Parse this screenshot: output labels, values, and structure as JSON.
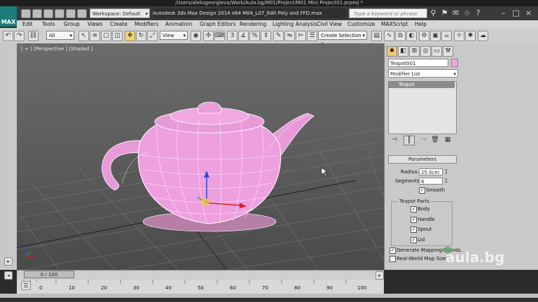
{
  "window": {
    "path": "/Users/aleksgeorgieva/Work/Aula.bg/M01/Project/M01 Mini Project01.prproj *",
    "logo": "MAX",
    "workspace": "Workspace: Default",
    "title": "Autodesk 3ds Max Design 2014 x64     M04_L07_Edit Poly and FFD.max",
    "search_placeholder": "Type a keyword or phrase"
  },
  "menu": [
    "Edit",
    "Tools",
    "Group",
    "Views",
    "Create",
    "Modifiers",
    "Animation",
    "Graph Editors",
    "Rendering",
    "Lighting Analysis",
    "Civil View",
    "Customize",
    "MAXScript",
    "Help"
  ],
  "toolbar": {
    "filter": "All",
    "ref_coord": "View",
    "selection_set": "Create Selection Se"
  },
  "viewport": {
    "label": "[ + ] [Perspective ] [Shaded ]",
    "object_color": "#ee9fe0",
    "wire_color": "#ffffff"
  },
  "command_panel": {
    "object_name": "Teapot001",
    "modifier_list": "Modifier List",
    "stack_item": "Teapot",
    "rollout": "Parameters",
    "radius_label": "Radius:",
    "radius": "25.0cm",
    "segments_label": "Segments:",
    "segments": "6",
    "smooth": "Smooth",
    "parts_title": "Teapot Parts",
    "parts": [
      "Body",
      "Handle",
      "Spout",
      "Lid"
    ],
    "gen_mapping": "Generate Mapping Coords.",
    "real_world": "Real-World Map Size"
  },
  "timeline": {
    "slider": "0 / 100",
    "ticks": [
      "0",
      "10",
      "20",
      "30",
      "40",
      "50",
      "60",
      "70",
      "80",
      "90",
      "100"
    ]
  },
  "watermark": "aula.bg"
}
